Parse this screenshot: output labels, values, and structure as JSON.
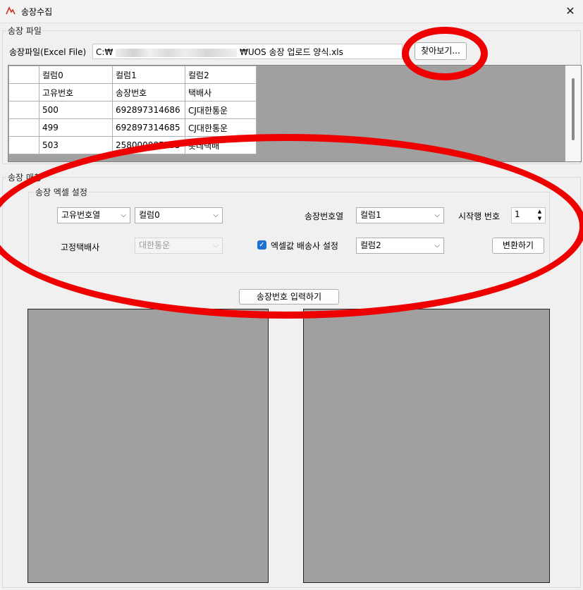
{
  "window": {
    "title": "송장수집",
    "icon": "app-logo-icon",
    "close_glyph": "✕"
  },
  "invoice_file": {
    "group_label": "송장 파일",
    "file_label": "송장파일(Excel File)",
    "path_prefix": "C:₩",
    "path_suffix": "₩UOS 송장 업로드 양식.xls",
    "browse_label": "찾아보기..."
  },
  "grid": {
    "columns": [
      "컬럼0",
      "컬럼1",
      "컬럼2"
    ],
    "rows": [
      [
        "고유번호",
        "송장번호",
        "택배사"
      ],
      [
        "500",
        "692897314686",
        "CJ대한통운"
      ],
      [
        "499",
        "692897314685",
        "CJ대한통운"
      ],
      [
        "503",
        "258000085565",
        "롯데택배"
      ]
    ]
  },
  "invoice_match": {
    "group_label": "송장 매칭",
    "excel_settings_label": "송장 엑셀 설정",
    "id_col_combo": "고유번호열",
    "id_col_value": "컬럼0",
    "invoice_col_label": "송장번호열",
    "invoice_col_value": "컬럼1",
    "start_row_label": "시작행 번호",
    "start_row_value": "1",
    "fixed_carrier_label": "고정택배사",
    "fixed_carrier_value": "대한통운",
    "excel_carrier_checkbox_label": "엑셀값 배송사 설정",
    "excel_carrier_checked": true,
    "carrier_col_value": "컬럼2",
    "convert_label": "변환하기",
    "submit_label": "송장번호 입력하기"
  },
  "colors": {
    "annotation": "#ee0000",
    "panel": "#a0a0a0",
    "checkbox": "#1e6fcf"
  }
}
